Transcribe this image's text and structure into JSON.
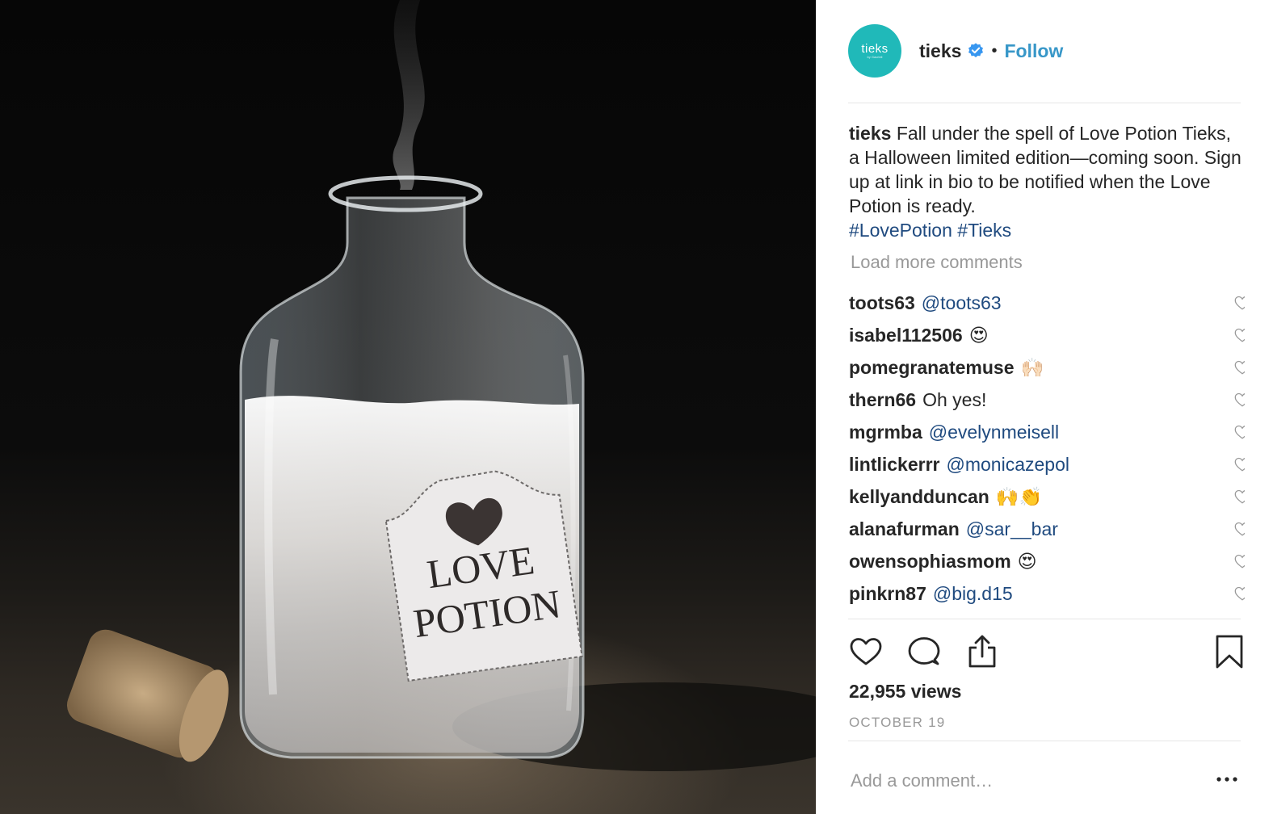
{
  "post_image": {
    "label_line1": "LOVE",
    "label_line2": "POTION"
  },
  "header": {
    "avatar_text": "tieks",
    "avatar_subtext": "by Gavrieli",
    "username": "tieks",
    "separator": "•",
    "follow_label": "Follow",
    "verified_icon": "verified-badge-icon",
    "accent_color": "#3897c8"
  },
  "caption": {
    "username": "tieks",
    "text": "Fall under the spell of Love Potion Tieks, a Halloween limited edition—coming soon. Sign up at link in bio to be notified when the Love Potion is ready.",
    "hashtag1": "#LovePotion",
    "hashtag2": "#Tieks"
  },
  "load_more": "Load more comments",
  "comments": [
    {
      "user": "toots63",
      "text": "@toots63"
    },
    {
      "user": "isabel112506",
      "text": "😍"
    },
    {
      "user": "pomegranatemuse",
      "text": "🙌🏻"
    },
    {
      "user": "thern66",
      "text": "Oh yes!"
    },
    {
      "user": "mgrmba",
      "text": "@evelynmeisell"
    },
    {
      "user": "lintlickerrr",
      "text": "@monicazepol"
    },
    {
      "user": "kellyandduncan",
      "text": "🙌👏"
    },
    {
      "user": "alanafurman",
      "text": "@sar__bar"
    },
    {
      "user": "owensophiasmom",
      "text": "😍"
    },
    {
      "user": "pinkrn87",
      "text": "@big.d15"
    }
  ],
  "actions": {
    "icons": [
      "heart-icon",
      "comment-icon",
      "share-icon",
      "bookmark-icon"
    ]
  },
  "views": "22,955 views",
  "date": "OCTOBER 19",
  "add_comment": {
    "placeholder": "Add a comment…"
  },
  "more_icon": "more-options-icon"
}
